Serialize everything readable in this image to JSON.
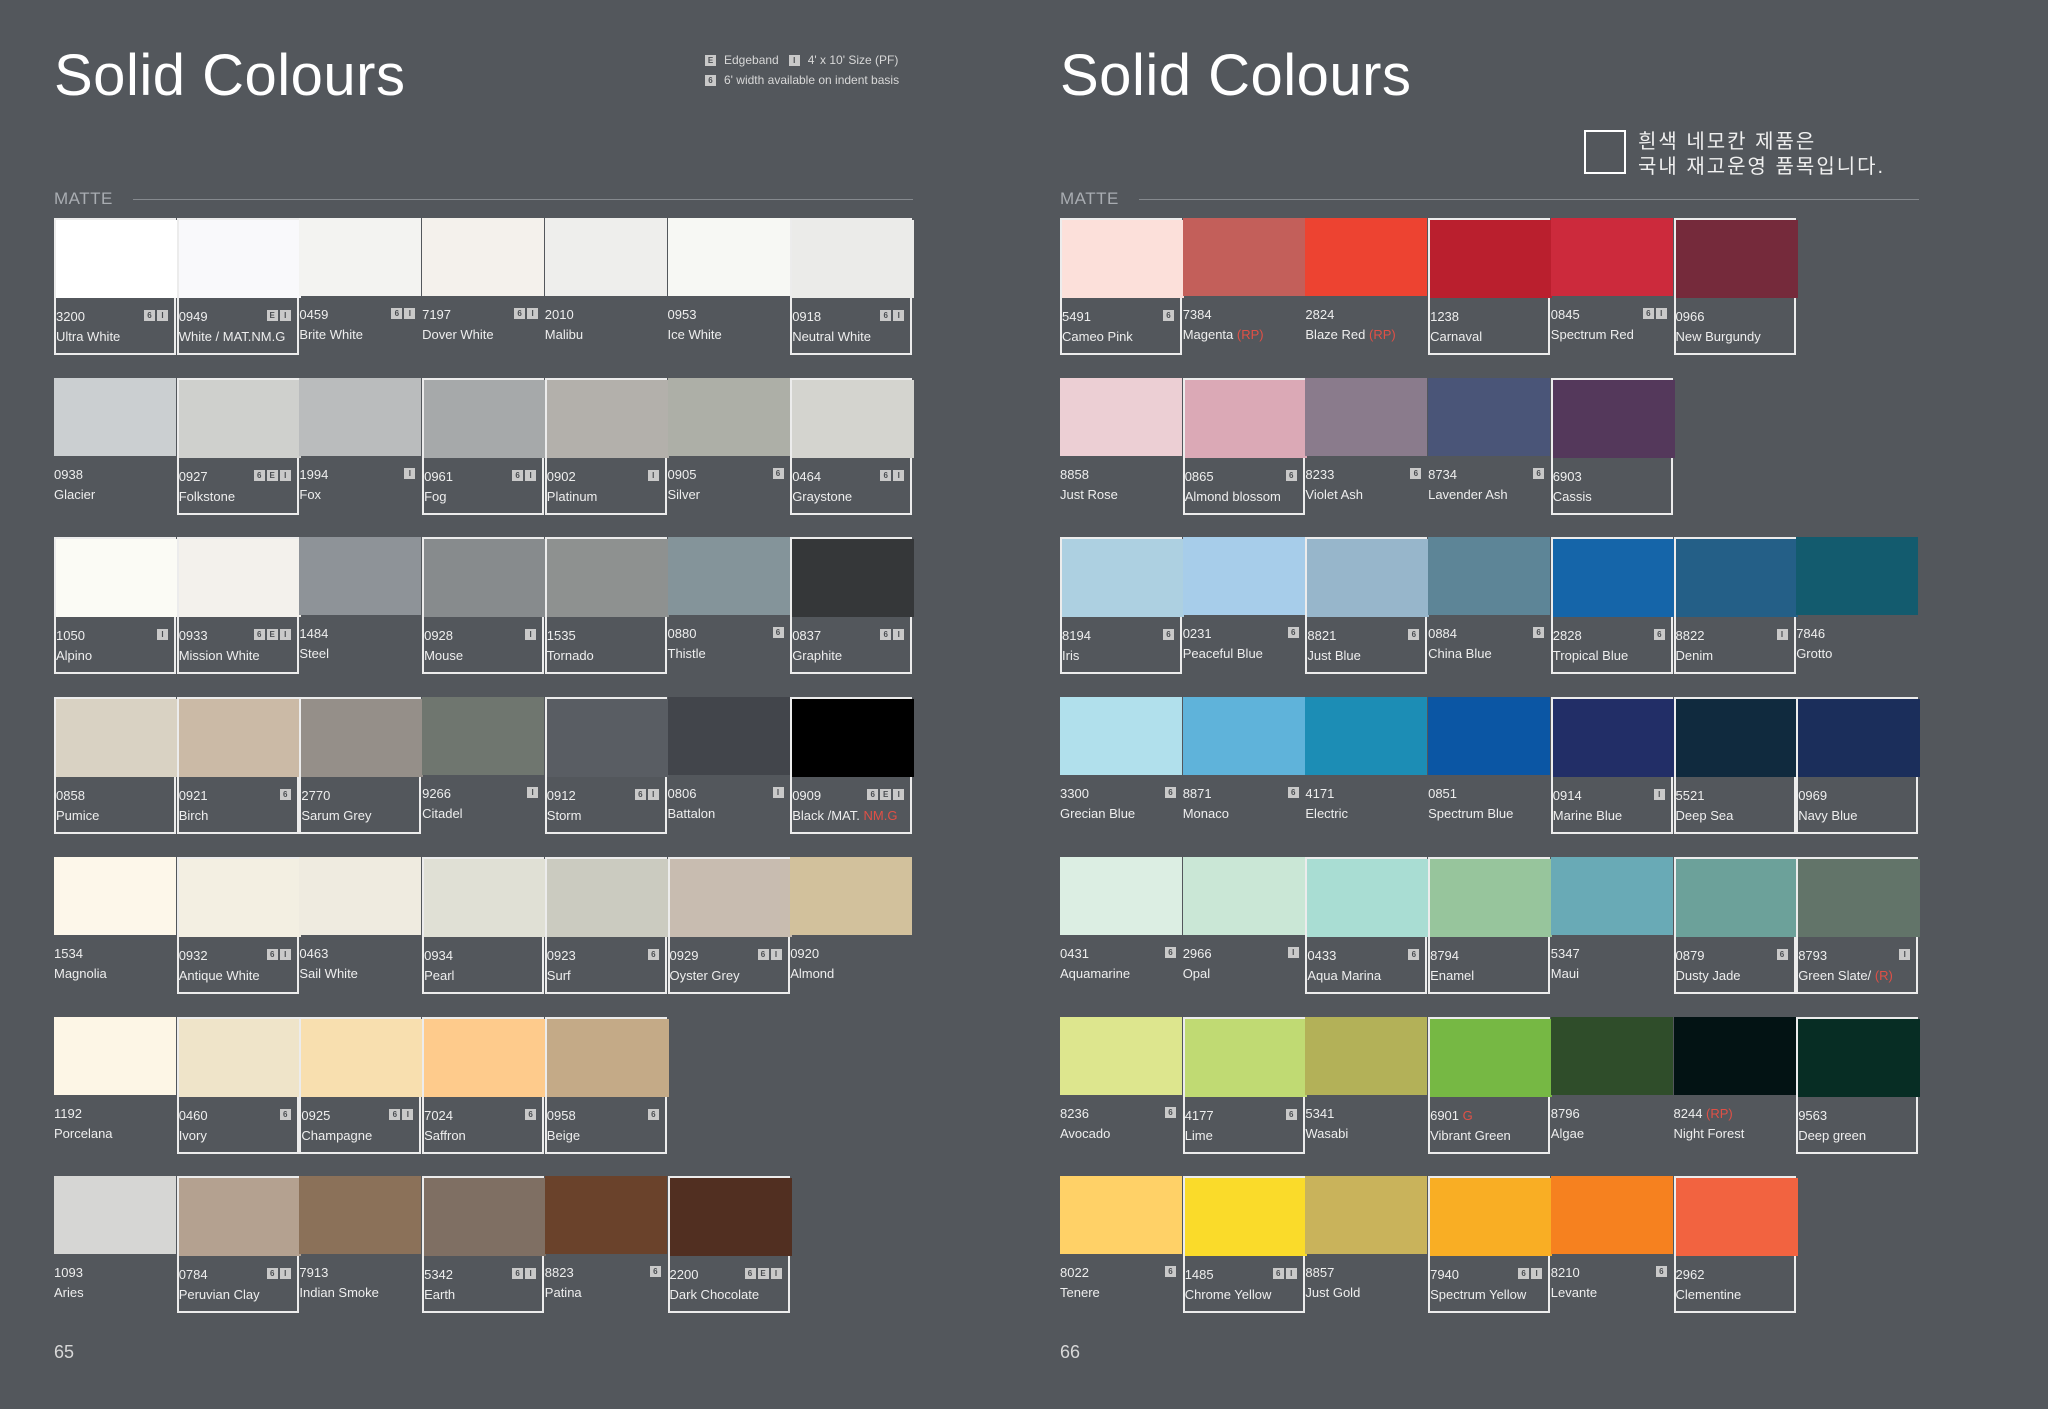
{
  "left_page": {
    "title": "Solid Colours",
    "legend": [
      {
        "badges": [
          "E"
        ],
        "text": "Edgeband",
        "badges2": [
          "I"
        ],
        "text2": "4' x 10' Size (PF)"
      },
      {
        "badges": [
          "6"
        ],
        "text": "6' width available on indent basis"
      }
    ],
    "section_label": "MATTE",
    "page_number": "65",
    "rows": [
      [
        {
          "code": "3200",
          "name": "Ultra White",
          "color": "#ffffff",
          "framed": true,
          "badges": [
            "6",
            "I"
          ]
        },
        {
          "code": "0949",
          "name": "White / MAT.NM.G",
          "color": "#f9f9fb",
          "framed": true,
          "badges": [
            "E",
            "I"
          ]
        },
        {
          "code": "0459",
          "name": "Brite White",
          "color": "#f3f3f1",
          "framed": false,
          "badges": [
            "6",
            "I"
          ]
        },
        {
          "code": "7197",
          "name": "Dover White",
          "color": "#f4f1ec",
          "framed": false,
          "badges": [
            "6",
            "I"
          ]
        },
        {
          "code": "2010",
          "name": "Malibu",
          "color": "#eeeeec",
          "framed": false,
          "badges": []
        },
        {
          "code": "0953",
          "name": "Ice White",
          "color": "#f7f8f4",
          "framed": false,
          "badges": []
        },
        {
          "code": "0918",
          "name": "Neutral White",
          "color": "#ebebe9",
          "framed": true,
          "badges": [
            "6",
            "I"
          ]
        }
      ],
      [
        {
          "code": "0938",
          "name": "Glacier",
          "color": "#cbcfd1",
          "framed": false,
          "badges": []
        },
        {
          "code": "0927",
          "name": "Folkstone",
          "color": "#cfd0cd",
          "framed": true,
          "badges": [
            "6",
            "E",
            "I"
          ]
        },
        {
          "code": "1994",
          "name": "Fox",
          "color": "#babcbd",
          "framed": false,
          "badges": [
            "I"
          ]
        },
        {
          "code": "0961",
          "name": "Fog",
          "color": "#a6a9aa",
          "framed": true,
          "badges": [
            "6",
            "I"
          ]
        },
        {
          "code": "0902",
          "name": "Platinum",
          "color": "#b3b0ab",
          "framed": true,
          "badges": [
            "I"
          ]
        },
        {
          "code": "0905",
          "name": "Silver",
          "color": "#adafa7",
          "framed": false,
          "badges": [
            "6"
          ]
        },
        {
          "code": "0464",
          "name": "Graystone",
          "color": "#d4d4cf",
          "framed": true,
          "badges": [
            "6",
            "I"
          ]
        }
      ],
      [
        {
          "code": "1050",
          "name": "Alpino",
          "color": "#fbfbf5",
          "framed": true,
          "badges": [
            "I"
          ]
        },
        {
          "code": "0933",
          "name": "Mission White",
          "color": "#f3f1ec",
          "framed": true,
          "badges": [
            "6",
            "E",
            "I"
          ]
        },
        {
          "code": "1484",
          "name": "Steel",
          "color": "#8e9398",
          "framed": false,
          "badges": []
        },
        {
          "code": "0928",
          "name": "Mouse",
          "color": "#878b8d",
          "framed": true,
          "badges": [
            "I"
          ]
        },
        {
          "code": "1535",
          "name": "Tornado",
          "color": "#8e9190",
          "framed": true,
          "badges": []
        },
        {
          "code": "0880",
          "name": "Thistle",
          "color": "#84949a",
          "framed": false,
          "badges": [
            "6"
          ]
        },
        {
          "code": "0837",
          "name": "Graphite",
          "color": "#353739",
          "framed": true,
          "badges": [
            "6",
            "I"
          ]
        }
      ],
      [
        {
          "code": "0858",
          "name": "Pumice",
          "color": "#d9d2c3",
          "framed": true,
          "badges": []
        },
        {
          "code": "0921",
          "name": "Birch",
          "color": "#cbbaa6",
          "framed": true,
          "badges": [
            "6"
          ]
        },
        {
          "code": "2770",
          "name": "Sarum Grey",
          "color": "#958f89",
          "framed": true,
          "badges": []
        },
        {
          "code": "9266",
          "name": "Citadel",
          "color": "#6f766f",
          "framed": false,
          "badges": [
            "I"
          ]
        },
        {
          "code": "0912",
          "name": "Storm",
          "color": "#595d63",
          "framed": true,
          "badges": [
            "6",
            "I"
          ]
        },
        {
          "code": "0806",
          "name": "Battalon",
          "color": "#42454b",
          "framed": false,
          "badges": [
            "I"
          ]
        },
        {
          "code": "0909",
          "name": "Black /MAT.",
          "mark": "NM.G",
          "color": "#000000",
          "framed": true,
          "badges": [
            "6",
            "E",
            "I"
          ]
        }
      ],
      [
        {
          "code": "1534",
          "name": "Magnolia",
          "color": "#fdf7ea",
          "framed": false,
          "badges": []
        },
        {
          "code": "0932",
          "name": "Antique White",
          "color": "#f3efe2",
          "framed": true,
          "badges": [
            "6",
            "I"
          ]
        },
        {
          "code": "0463",
          "name": "Sail White",
          "color": "#efebe0",
          "framed": false,
          "badges": []
        },
        {
          "code": "0934",
          "name": "Pearl",
          "color": "#e0e0d5",
          "framed": true,
          "badges": []
        },
        {
          "code": "0923",
          "name": "Surf",
          "color": "#cbcbc0",
          "framed": true,
          "badges": [
            "6"
          ]
        },
        {
          "code": "0929",
          "name": "Oyster Grey",
          "color": "#c8bcb0",
          "framed": true,
          "badges": [
            "6",
            "I"
          ]
        },
        {
          "code": "0920",
          "name": "Almond",
          "color": "#d2c19c",
          "framed": false,
          "badges": []
        }
      ],
      [
        {
          "code": "1192",
          "name": "Porcelana",
          "color": "#fdf6e6",
          "framed": false,
          "badges": []
        },
        {
          "code": "0460",
          "name": "Ivory",
          "color": "#efe4c9",
          "framed": true,
          "badges": [
            "6"
          ]
        },
        {
          "code": "0925",
          "name": "Champagne",
          "color": "#f8dfaf",
          "framed": true,
          "badges": [
            "6",
            "I"
          ]
        },
        {
          "code": "7024",
          "name": "Saffron",
          "color": "#fecb8c",
          "framed": true,
          "badges": [
            "6"
          ]
        },
        {
          "code": "0958",
          "name": "Beige",
          "color": "#c4aa87",
          "framed": true,
          "badges": [
            "6"
          ]
        }
      ],
      [
        {
          "code": "1093",
          "name": "Aries",
          "color": "#d6d6d4",
          "framed": false,
          "badges": []
        },
        {
          "code": "0784",
          "name": "Peruvian Clay",
          "color": "#b4a190",
          "framed": true,
          "badges": [
            "6",
            "I"
          ]
        },
        {
          "code": "7913",
          "name": "Indian Smoke",
          "color": "#8b7159",
          "framed": false,
          "badges": []
        },
        {
          "code": "5342",
          "name": "Earth",
          "color": "#7f6f63",
          "framed": true,
          "badges": [
            "6",
            "I"
          ]
        },
        {
          "code": "8823",
          "name": "Patina",
          "color": "#6a422b",
          "framed": false,
          "badges": [
            "6"
          ]
        },
        {
          "code": "2200",
          "name": "Dark Chocolate",
          "color": "#512f21",
          "framed": true,
          "badges": [
            "6",
            "E",
            "I"
          ]
        }
      ]
    ]
  },
  "right_page": {
    "title": "Solid Colours",
    "notice_lines": [
      "흰색 네모칸 제품은",
      "국내 재고운영 품목입니다."
    ],
    "section_label": "MATTE",
    "page_number": "66",
    "rows": [
      [
        {
          "code": "5491",
          "name": "Cameo Pink",
          "color": "#fce0da",
          "framed": true,
          "badges": [
            "6"
          ]
        },
        {
          "code": "7384",
          "name": "Magenta",
          "mark": "(RP)",
          "color": "#c35f5a",
          "framed": false,
          "badges": []
        },
        {
          "code": "2824",
          "name": "Blaze Red",
          "mark": "(RP)",
          "color": "#ed4331",
          "framed": false,
          "badges": []
        },
        {
          "code": "1238",
          "name": "Carnaval",
          "color": "#ba1f2e",
          "framed": true,
          "badges": []
        },
        {
          "code": "0845",
          "name": "Spectrum Red",
          "color": "#cc2a3c",
          "framed": false,
          "badges": [
            "6",
            "I"
          ]
        },
        {
          "code": "0966",
          "name": "New Burgundy",
          "color": "#752a3b",
          "framed": true,
          "badges": []
        }
      ],
      [
        {
          "code": "8858",
          "name": "Just Rose",
          "color": "#eccfd4",
          "framed": false,
          "badges": []
        },
        {
          "code": "0865",
          "name": "Almond blossom",
          "color": "#dba9b6",
          "framed": true,
          "badges": [
            "6"
          ]
        },
        {
          "code": "8233",
          "name": "Violet Ash",
          "color": "#8a7b8c",
          "framed": false,
          "badges": [
            "6"
          ]
        },
        {
          "code": "8734",
          "name": "Lavender Ash",
          "color": "#4a5578",
          "framed": false,
          "badges": [
            "6"
          ]
        },
        {
          "code": "6903",
          "name": "Cassis",
          "color": "#54385b",
          "framed": true,
          "badges": []
        }
      ],
      [
        {
          "code": "8194",
          "name": "Iris",
          "color": "#add0e1",
          "framed": true,
          "badges": [
            "6"
          ]
        },
        {
          "code": "0231",
          "name": "Peaceful Blue",
          "color": "#a7cdea",
          "framed": false,
          "badges": [
            "6"
          ]
        },
        {
          "code": "8821",
          "name": "Just Blue",
          "color": "#97b6cb",
          "framed": true,
          "badges": [
            "6"
          ]
        },
        {
          "code": "0884",
          "name": "China Blue",
          "color": "#5d8597",
          "framed": false,
          "badges": [
            "6"
          ]
        },
        {
          "code": "2828",
          "name": "Tropical Blue",
          "color": "#1565a9",
          "framed": true,
          "badges": [
            "6"
          ]
        },
        {
          "code": "8822",
          "name": "Denim",
          "color": "#245f87",
          "framed": true,
          "badges": [
            "I"
          ]
        },
        {
          "code": "7846",
          "name": "Grotto",
          "color": "#135b6e",
          "framed": false,
          "badges": []
        }
      ],
      [
        {
          "code": "3300",
          "name": "Grecian Blue",
          "color": "#b1e0ec",
          "framed": false,
          "badges": [
            "6"
          ]
        },
        {
          "code": "8871",
          "name": "Monaco",
          "color": "#5fb3da",
          "framed": false,
          "badges": [
            "6"
          ]
        },
        {
          "code": "4171",
          "name": "Electric",
          "color": "#1c8db5",
          "framed": false,
          "badges": []
        },
        {
          "code": "0851",
          "name": "Spectrum Blue",
          "color": "#0b56a4",
          "framed": false,
          "badges": []
        },
        {
          "code": "0914",
          "name": "Marine Blue",
          "color": "#222e67",
          "framed": true,
          "badges": [
            "I"
          ]
        },
        {
          "code": "5521",
          "name": "Deep Sea",
          "color": "#102a3e",
          "framed": true,
          "badges": []
        },
        {
          "code": "0969",
          "name": "Navy Blue",
          "color": "#1b2e5b",
          "framed": true,
          "badges": []
        }
      ],
      [
        {
          "code": "0431",
          "name": "Aquamarine",
          "color": "#dceee3",
          "framed": false,
          "badges": [
            "6"
          ]
        },
        {
          "code": "2966",
          "name": "Opal",
          "color": "#cae7d6",
          "framed": false,
          "badges": [
            "I"
          ]
        },
        {
          "code": "0433",
          "name": "Aqua Marina",
          "color": "#a9ddd3",
          "framed": true,
          "badges": [
            "6"
          ]
        },
        {
          "code": "8794",
          "name": "Enamel",
          "color": "#97c59c",
          "framed": true,
          "badges": []
        },
        {
          "code": "5347",
          "name": "Maui",
          "color": "#69aab6",
          "framed": false,
          "badges": []
        },
        {
          "code": "0879",
          "name": "Dusty Jade",
          "color": "#6ca19a",
          "framed": true,
          "badges": [
            "6"
          ]
        },
        {
          "code": "8793",
          "name": "Green Slate/",
          "mark": "(R)",
          "color": "#627469",
          "framed": true,
          "badges": [
            "I"
          ]
        }
      ],
      [
        {
          "code": "8236",
          "name": "Avocado",
          "color": "#dde68e",
          "framed": false,
          "badges": [
            "6"
          ]
        },
        {
          "code": "4177",
          "name": "Lime",
          "color": "#c0da73",
          "framed": true,
          "badges": [
            "6"
          ]
        },
        {
          "code": "5341",
          "name": "Wasabi",
          "color": "#b3b158",
          "framed": false,
          "badges": []
        },
        {
          "code": "6901",
          "name": "Vibrant Green",
          "mark": "G",
          "codeMark": true,
          "color": "#76b844",
          "framed": true,
          "badges": []
        },
        {
          "code": "8796",
          "name": "Algae",
          "color": "#2f4d2a",
          "framed": false,
          "badges": []
        },
        {
          "code": "8244",
          "name": "Night Forest",
          "mark": "(RP)",
          "codeMark": true,
          "color": "#031314",
          "framed": false,
          "badges": []
        },
        {
          "code": "9563",
          "name": "Deep green",
          "color": "#072d24",
          "framed": true,
          "badges": []
        }
      ],
      [
        {
          "code": "8022",
          "name": "Tenere",
          "color": "#ffd167",
          "framed": false,
          "badges": [
            "6"
          ]
        },
        {
          "code": "1485",
          "name": "Chrome Yellow",
          "color": "#fadb2a",
          "framed": true,
          "badges": [
            "6",
            "I"
          ]
        },
        {
          "code": "8857",
          "name": "Just Gold",
          "color": "#c9b35b",
          "framed": false,
          "badges": []
        },
        {
          "code": "7940",
          "name": "Spectrum Yellow",
          "color": "#f9ae24",
          "framed": true,
          "badges": [
            "6",
            "I"
          ]
        },
        {
          "code": "8210",
          "name": "Levante",
          "color": "#f6811f",
          "framed": false,
          "badges": [
            "6"
          ]
        },
        {
          "code": "2962",
          "name": "Clementine",
          "color": "#f26340",
          "framed": true,
          "badges": []
        }
      ]
    ]
  }
}
